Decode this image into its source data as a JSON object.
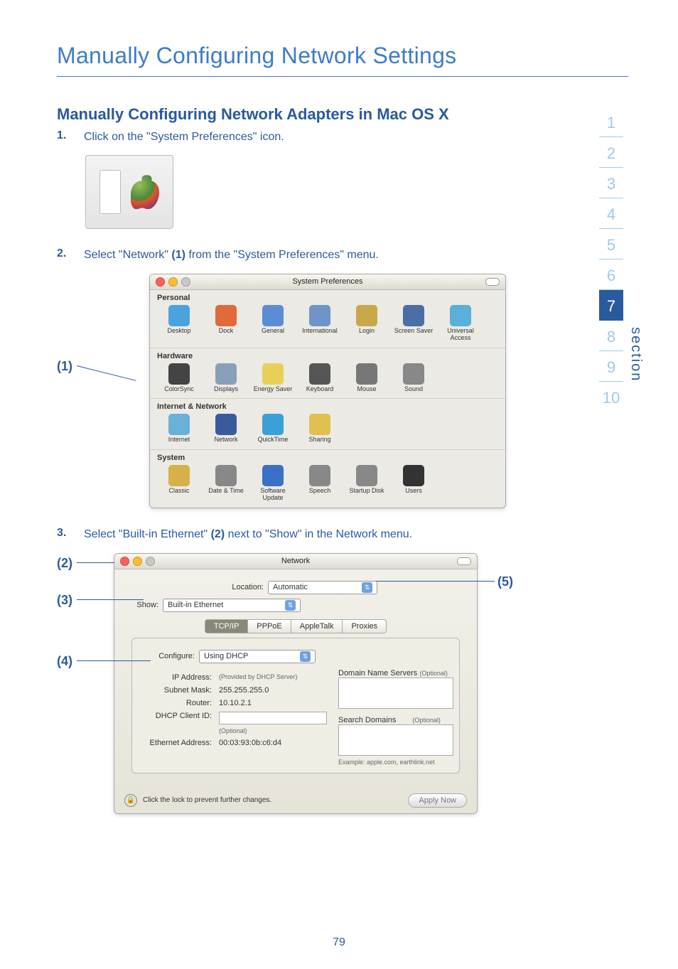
{
  "page_title": "Manually Configuring Network Settings",
  "subtitle": "Manually Configuring Network Adapters in Mac OS X",
  "steps": [
    {
      "num": "1.",
      "text": "Click on the \"System Preferences\" icon."
    },
    {
      "num": "2.",
      "text_a": "Select \"Network\" ",
      "ref": "(1)",
      "text_b": " from the \"System Preferences\" menu."
    },
    {
      "num": "3.",
      "text_a": "Select \"Built-in Ethernet\" ",
      "ref": "(2)",
      "text_b": " next to \"Show\" in the Network menu."
    }
  ],
  "callouts": {
    "c1": "(1)",
    "c2": "(2)",
    "c3": "(3)",
    "c4": "(4)",
    "c5": "(5)"
  },
  "section_nav": [
    "1",
    "2",
    "3",
    "4",
    "5",
    "6",
    "7",
    "8",
    "9",
    "10"
  ],
  "section_nav_active_index": 6,
  "section_label": "section",
  "page_number": "79",
  "sp_window": {
    "title": "System Preferences",
    "groups": [
      {
        "header": "Personal",
        "items": [
          "Desktop",
          "Dock",
          "General",
          "International",
          "Login",
          "Screen Saver",
          "Universal Access"
        ]
      },
      {
        "header": "Hardware",
        "items": [
          "ColorSync",
          "Displays",
          "Energy Saver",
          "Keyboard",
          "Mouse",
          "Sound"
        ]
      },
      {
        "header": "Internet & Network",
        "items": [
          "Internet",
          "Network",
          "QuickTime",
          "Sharing"
        ]
      },
      {
        "header": "System",
        "items": [
          "Classic",
          "Date & Time",
          "Software Update",
          "Speech",
          "Startup Disk",
          "Users"
        ]
      }
    ],
    "icon_colors": {
      "Desktop": "#4aa3df",
      "Dock": "#e06a3a",
      "General": "#5a8dd6",
      "International": "#6f94c8",
      "Login": "#c9a84a",
      "Screen Saver": "#4a6fa5",
      "Universal Access": "#5ab0d8",
      "ColorSync": "#444",
      "Displays": "#8aa0b8",
      "Energy Saver": "#e9cf5a",
      "Keyboard": "#555",
      "Mouse": "#777",
      "Sound": "#888",
      "Internet": "#6bb0d8",
      "Network": "#3a5a9e",
      "QuickTime": "#3aa0d8",
      "Sharing": "#e0c050",
      "Classic": "#d8b04a",
      "Date & Time": "#888",
      "Software Update": "#3a70c8",
      "Speech": "#888",
      "Startup Disk": "#888",
      "Users": "#333"
    }
  },
  "net_window": {
    "title": "Network",
    "location_label": "Location:",
    "location_value": "Automatic",
    "show_label": "Show:",
    "show_value": "Built-in Ethernet",
    "tabs": [
      "TCP/IP",
      "PPPoE",
      "AppleTalk",
      "Proxies"
    ],
    "active_tab": "TCP/IP",
    "configure_label": "Configure:",
    "configure_value": "Using DHCP",
    "dns_label": "Domain Name Servers",
    "dns_opt": "(Optional)",
    "ip_label": "IP Address:",
    "ip_hint": "(Provided by DHCP Server)",
    "subnet_label": "Subnet Mask:",
    "subnet_value": "255.255.255.0",
    "router_label": "Router:",
    "router_value": "10.10.2.1",
    "search_label": "Search Domains",
    "search_opt": "(Optional)",
    "dhcp_client_label": "DHCP Client ID:",
    "dhcp_client_hint": "(Optional)",
    "example_hint": "Example: apple.com, earthlink.net",
    "eth_label": "Ethernet Address:",
    "eth_value": "00:03:93:0b:c6:d4",
    "lock_text": "Click the lock to prevent further changes.",
    "apply_btn": "Apply Now"
  }
}
